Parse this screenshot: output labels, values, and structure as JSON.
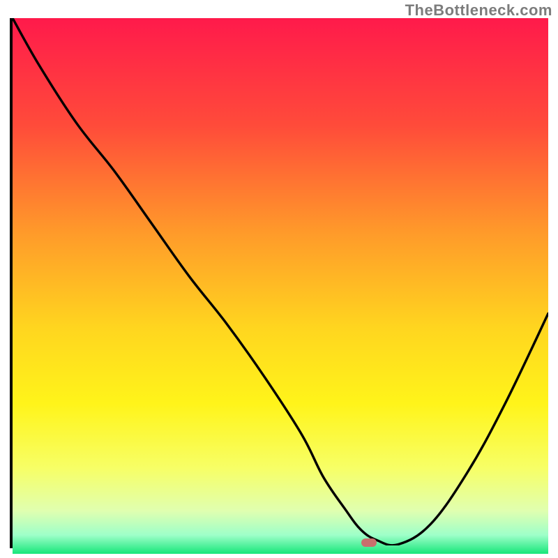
{
  "watermark": "TheBottleneck.com",
  "chart_data": {
    "type": "line",
    "title": "",
    "xlabel": "",
    "ylabel": "",
    "xlim": [
      0,
      100
    ],
    "ylim": [
      0,
      100
    ],
    "grid": false,
    "legend": false,
    "gradient_stops": [
      {
        "offset": 0.0,
        "color": "#ff1a4b"
      },
      {
        "offset": 0.2,
        "color": "#ff4b3a"
      },
      {
        "offset": 0.4,
        "color": "#ff9a2a"
      },
      {
        "offset": 0.58,
        "color": "#ffd61f"
      },
      {
        "offset": 0.72,
        "color": "#fff41a"
      },
      {
        "offset": 0.84,
        "color": "#f7ff66"
      },
      {
        "offset": 0.92,
        "color": "#e0ffb0"
      },
      {
        "offset": 0.965,
        "color": "#9effc9"
      },
      {
        "offset": 1.0,
        "color": "#17e67a"
      }
    ],
    "series": [
      {
        "name": "curve",
        "x": [
          0,
          5,
          12,
          19,
          26,
          33,
          40,
          47,
          54,
          58,
          62,
          65,
          68,
          72,
          78,
          85,
          92,
          100
        ],
        "values": [
          100,
          91,
          80,
          71,
          61,
          51,
          42,
          32,
          21,
          13,
          7,
          3,
          1,
          0.2,
          4,
          14,
          27,
          44
        ]
      }
    ],
    "marker": {
      "x": 66.5,
      "y": 0.5,
      "color": "#c96f6d"
    }
  }
}
